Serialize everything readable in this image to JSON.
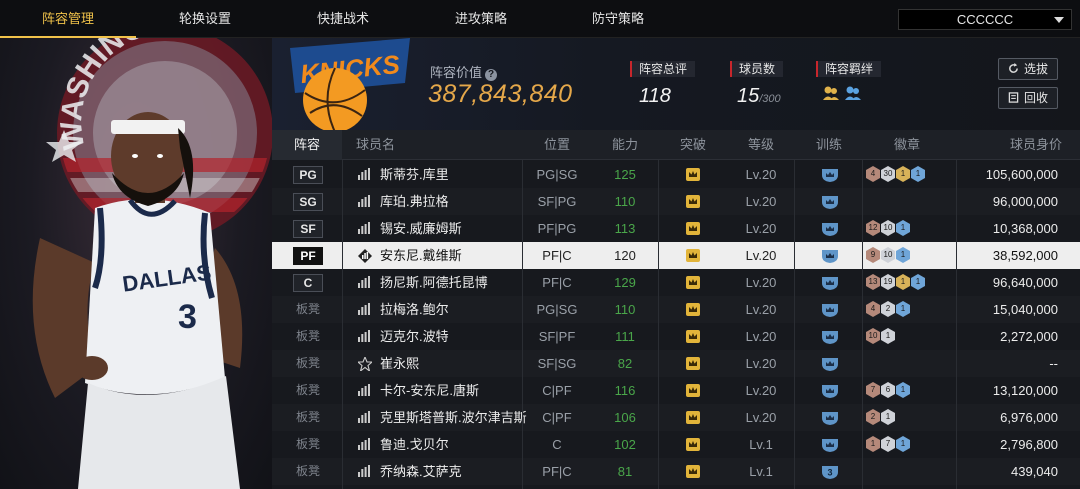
{
  "nav": {
    "tabs": [
      "阵容管理",
      "轮换设置",
      "快捷战术",
      "进攻策略",
      "防守策略"
    ],
    "active_tab": 0,
    "team_select": "CCCCCC"
  },
  "header": {
    "value_label": "阵容价值",
    "value": "387,843,840",
    "total_rating_label": "阵容总评",
    "total_rating": "118",
    "player_count_label": "球员数",
    "player_count": "15",
    "player_count_max": "/300",
    "bond_label": "阵容羁绊",
    "select_button": "选拔",
    "recycle_button": "回收"
  },
  "table": {
    "columns": [
      "阵容",
      "球员名",
      "位置",
      "能力",
      "突破",
      "等级",
      "训练",
      "徽章",
      "球员身价"
    ],
    "rows": [
      {
        "slot": "PG",
        "name": "斯蒂芬.库里",
        "pos": "PG|SG",
        "ability": "125",
        "level": "Lv.20",
        "train": "",
        "badges": [
          [
            "bronze",
            "4"
          ],
          [
            "silver",
            "30"
          ],
          [
            "gold",
            "1"
          ],
          [
            "blue",
            "1"
          ]
        ],
        "value": "105,600,000"
      },
      {
        "slot": "SG",
        "name": "库珀.弗拉格",
        "pos": "SF|PG",
        "ability": "110",
        "level": "Lv.20",
        "train": "",
        "badges": [],
        "value": "96,000,000"
      },
      {
        "slot": "SF",
        "name": "锡安.威廉姆斯",
        "pos": "PF|PG",
        "ability": "113",
        "level": "Lv.20",
        "train": "",
        "badges": [
          [
            "bronze",
            "12"
          ],
          [
            "silver",
            "10"
          ],
          [
            "blue",
            "1"
          ]
        ],
        "value": "10,368,000"
      },
      {
        "slot": "PF",
        "name": "安东尼.戴维斯",
        "pos": "PF|C",
        "ability": "120",
        "level": "Lv.20",
        "train": "",
        "badges": [
          [
            "bronze",
            "9"
          ],
          [
            "silver",
            "10"
          ],
          [
            "blue",
            "1"
          ]
        ],
        "value": "38,592,000"
      },
      {
        "slot": "C",
        "name": "扬尼斯.阿德托昆博",
        "pos": "PF|C",
        "ability": "129",
        "level": "Lv.20",
        "train": "",
        "badges": [
          [
            "bronze",
            "13"
          ],
          [
            "silver",
            "19"
          ],
          [
            "gold",
            "1"
          ],
          [
            "blue",
            "1"
          ]
        ],
        "value": "96,640,000"
      },
      {
        "slot": "板凳",
        "name": "拉梅洛.鲍尔",
        "pos": "PG|SG",
        "ability": "110",
        "level": "Lv.20",
        "train": "",
        "badges": [
          [
            "bronze",
            "4"
          ],
          [
            "silver",
            "2"
          ],
          [
            "blue",
            "1"
          ]
        ],
        "value": "15,040,000"
      },
      {
        "slot": "板凳",
        "name": "迈克尔.波特",
        "pos": "SF|PF",
        "ability": "111",
        "level": "Lv.20",
        "train": "",
        "badges": [
          [
            "bronze",
            "10"
          ],
          [
            "silver",
            "1"
          ]
        ],
        "value": "2,272,000"
      },
      {
        "slot": "板凳",
        "name": "崔永熙",
        "pos": "SF|SG",
        "ability": "82",
        "level": "Lv.20",
        "train": "",
        "badges": [],
        "value": "--"
      },
      {
        "slot": "板凳",
        "name": "卡尔-安东尼.唐斯",
        "pos": "C|PF",
        "ability": "116",
        "level": "Lv.20",
        "train": "",
        "badges": [
          [
            "bronze",
            "7"
          ],
          [
            "silver",
            "6"
          ],
          [
            "blue",
            "1"
          ]
        ],
        "value": "13,120,000"
      },
      {
        "slot": "板凳",
        "name": "克里斯塔普斯.波尔津吉斯",
        "pos": "C|PF",
        "ability": "106",
        "level": "Lv.20",
        "train": "",
        "badges": [
          [
            "bronze",
            "2"
          ],
          [
            "silver",
            "1"
          ]
        ],
        "value": "6,976,000"
      },
      {
        "slot": "板凳",
        "name": "鲁迪.戈贝尔",
        "pos": "C",
        "ability": "102",
        "level": "Lv.1",
        "train": "",
        "badges": [
          [
            "bronze",
            "1"
          ],
          [
            "silver",
            "7"
          ],
          [
            "blue",
            "1"
          ]
        ],
        "value": "2,796,800"
      },
      {
        "slot": "板凳",
        "name": "乔纳森.艾萨克",
        "pos": "PF|C",
        "ability": "81",
        "level": "Lv.1",
        "train": "3",
        "badges": [],
        "value": "439,040"
      }
    ],
    "selected_row": 3
  },
  "hero": {
    "backdrop_text": "WASHINGTON",
    "jersey_team": "DALLAS",
    "jersey_number": "3"
  },
  "logo": {
    "text": "KNICKS"
  }
}
